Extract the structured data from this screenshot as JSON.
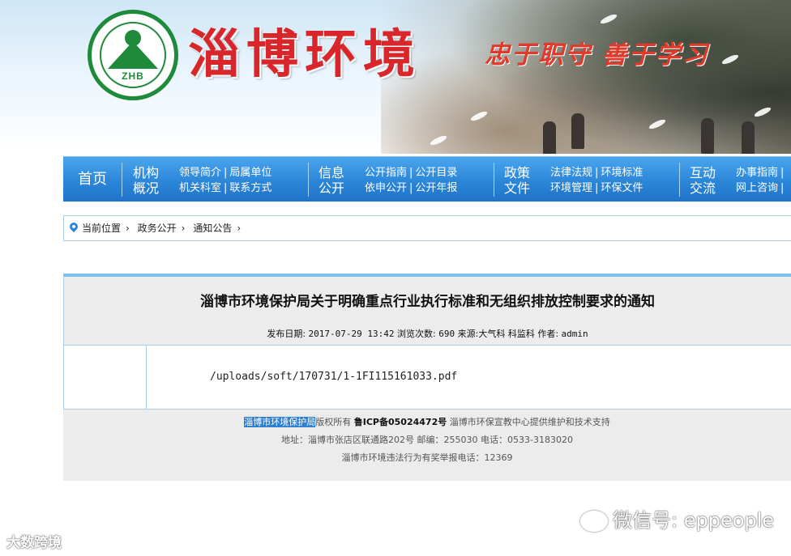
{
  "header": {
    "logo_text": "ZHB",
    "site_title": "淄博环境",
    "slogan": "忠于职守 善于学习"
  },
  "nav": {
    "home": "首页",
    "groups": [
      {
        "title_line1": "机构",
        "title_line2": "概况",
        "links": [
          [
            "领导简介",
            "局属单位"
          ],
          [
            "机关科室",
            "联系方式"
          ]
        ]
      },
      {
        "title_line1": "信息",
        "title_line2": "公开",
        "links": [
          [
            "公开指南",
            "公开目录"
          ],
          [
            "依申公开",
            "公开年报"
          ]
        ]
      },
      {
        "title_line1": "政策",
        "title_line2": "文件",
        "links": [
          [
            "法律法规",
            "环境标准"
          ],
          [
            "环境管理",
            "环保文件"
          ]
        ]
      },
      {
        "title_line1": "互动",
        "title_line2": "交流",
        "links": [
          [
            "办事指南",
            ""
          ],
          [
            "网上咨询",
            ""
          ]
        ]
      }
    ]
  },
  "breadcrumb": {
    "items": [
      "当前位置",
      "政务公开",
      "通知公告"
    ]
  },
  "article": {
    "title": "淄博市环境保护局关于明确重点行业执行标准和无组织排放控制要求的通知",
    "meta_label_date": "发布日期:",
    "meta_date": "2017-07-29 13:42",
    "meta_label_views": "浏览次数:",
    "meta_views": "690",
    "meta_label_source": "来源:",
    "meta_source": "大气科 科监科",
    "meta_label_author": "作者:",
    "meta_author": "admin",
    "attachment_path": "/uploads/soft/170731/1-1FI115161033.pdf"
  },
  "footer": {
    "owner": "淄博市环境保护局",
    "copyright": "版权所有",
    "icp": "鲁ICP备05024472号",
    "support": "淄博市环保宣教中心提供维护和技术支持",
    "address_line": "地址：淄博市张店区联通路202号  邮编：255030  电话：0533-3183020",
    "report_line": "淄博市环境违法行为有奖举报电话：12369"
  },
  "watermarks": {
    "left": "大数跨境",
    "right": "微信号: eppeople"
  }
}
